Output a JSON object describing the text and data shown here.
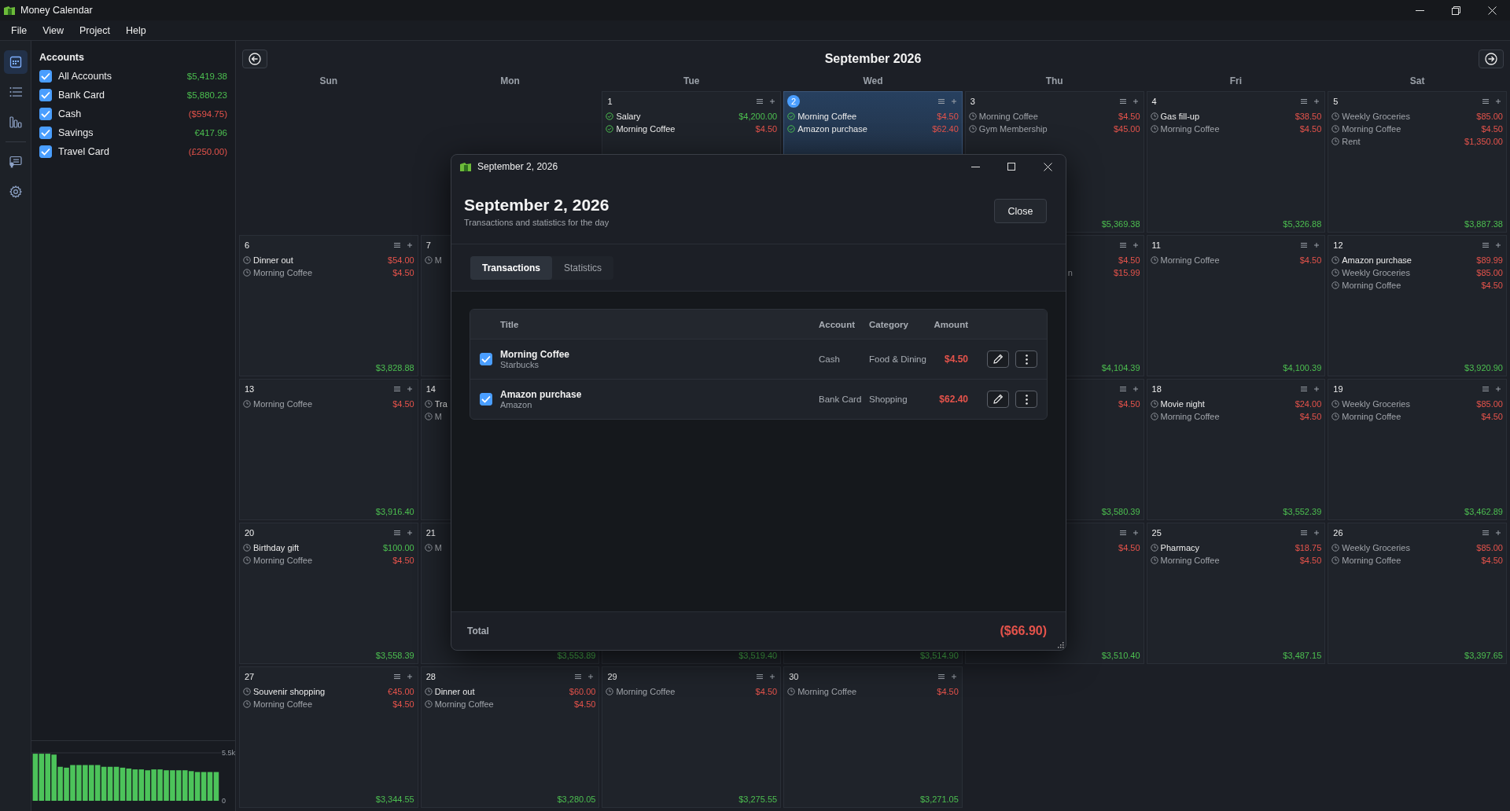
{
  "window": {
    "title": "Money Calendar"
  },
  "menu": [
    "File",
    "View",
    "Project",
    "Help"
  ],
  "rail": [
    {
      "kind": "calendar",
      "selected": true
    },
    {
      "kind": "list",
      "selected": false
    },
    {
      "kind": "chart",
      "selected": false
    },
    {
      "kind": "document",
      "selected": false
    },
    {
      "kind": "settings",
      "selected": false
    }
  ],
  "accounts": {
    "title": "Accounts",
    "items": [
      {
        "name": "All Accounts",
        "balance": "$5,419.38",
        "negative": false,
        "checked": true
      },
      {
        "name": "Bank Card",
        "balance": "$5,880.23",
        "negative": false,
        "checked": true
      },
      {
        "name": "Cash",
        "balance": "($594.75)",
        "negative": true,
        "checked": true
      },
      {
        "name": "Savings",
        "balance": "€417.96",
        "negative": false,
        "checked": true
      },
      {
        "name": "Travel Card",
        "balance": "(£250.00)",
        "negative": true,
        "checked": true
      }
    ]
  },
  "balance_chart": {
    "chart_data": {
      "type": "bar",
      "values": [
        5400,
        5400,
        5400,
        5300,
        3900,
        3800,
        4100,
        4100,
        4100,
        4100,
        4100,
        3900,
        3900,
        3900,
        3800,
        3700,
        3600,
        3600,
        3500,
        3600,
        3600,
        3500,
        3500,
        3500,
        3500,
        3400,
        3300,
        3300,
        3300,
        3300
      ],
      "ylim": [
        0,
        5500
      ],
      "yticks": [
        0,
        {
          "value": 5500,
          "label": "5.5k"
        }
      ]
    }
  },
  "calendar": {
    "month": "September 2026",
    "weekdays": [
      "Sun",
      "Mon",
      "Tue",
      "Wed",
      "Thu",
      "Fri",
      "Sat"
    ],
    "cells": [
      {
        "kind": "empty"
      },
      {
        "kind": "empty"
      },
      {
        "kind": "day",
        "day": "1",
        "selected": false,
        "actions": true,
        "items": [
          {
            "kind": "done",
            "title": "Salary",
            "amount": "$4,200.00",
            "income": true
          },
          {
            "kind": "done",
            "title": "Morning Coffee",
            "amount": "$4.50",
            "income": false
          }
        ]
      },
      {
        "kind": "day",
        "day": "2",
        "selected": true,
        "actions": true,
        "items": [
          {
            "kind": "done",
            "title": "Morning Coffee",
            "amount": "$4.50",
            "income": false
          },
          {
            "kind": "done",
            "title": "Amazon purchase",
            "amount": "$62.40",
            "income": false
          }
        ]
      },
      {
        "kind": "day",
        "day": "3",
        "selected": false,
        "actions": true,
        "items": [
          {
            "kind": "scheduled",
            "title": "Morning Coffee",
            "amount": "$4.50",
            "income": false,
            "recurring": true
          },
          {
            "kind": "scheduled",
            "title": "Gym Membership",
            "amount": "$45.00",
            "income": false,
            "recurring": true
          }
        ],
        "balance": "$5,369.38"
      },
      {
        "kind": "day",
        "day": "4",
        "selected": false,
        "actions": true,
        "items": [
          {
            "kind": "scheduled",
            "title": "Gas fill-up",
            "amount": "$38.50",
            "income": false,
            "recurring": false
          },
          {
            "kind": "scheduled",
            "title": "Morning Coffee",
            "amount": "$4.50",
            "income": false,
            "recurring": true
          }
        ],
        "balance": "$5,326.88"
      },
      {
        "kind": "day",
        "day": "5",
        "selected": false,
        "actions": true,
        "items": [
          {
            "kind": "scheduled",
            "title": "Weekly Groceries",
            "amount": "$85.00",
            "income": false,
            "recurring": true
          },
          {
            "kind": "scheduled",
            "title": "Morning Coffee",
            "amount": "$4.50",
            "income": false,
            "recurring": true
          },
          {
            "kind": "scheduled",
            "title": "Rent",
            "amount": "$1,350.00",
            "income": false,
            "recurring": true
          }
        ],
        "balance": "$3,887.38"
      },
      {
        "kind": "day",
        "day": "6",
        "selected": false,
        "actions": true,
        "items": [
          {
            "kind": "scheduled",
            "title": "Dinner out",
            "amount": "$54.00",
            "income": false,
            "recurring": false
          },
          {
            "kind": "scheduled",
            "title": "Morning Coffee",
            "amount": "$4.50",
            "income": false,
            "recurring": true
          }
        ],
        "balance": "$3,828.88"
      },
      {
        "kind": "day",
        "day": "7",
        "selected": false,
        "items": [
          {
            "kind": "scheduled",
            "title": "M",
            "recurring": true
          }
        ]
      },
      {
        "kind": "empty"
      },
      {
        "kind": "empty"
      },
      {
        "kind": "day",
        "selected": false,
        "actions": true,
        "items": [
          {
            "amount": "$4.50",
            "income": false
          },
          {
            "title": "n",
            "tail": true,
            "amount": "$15.99",
            "income": false,
            "recurring": true
          }
        ],
        "balance": "$4,104.39"
      },
      {
        "kind": "day",
        "day": "11",
        "selected": false,
        "actions": true,
        "items": [
          {
            "kind": "scheduled",
            "title": "Morning Coffee",
            "amount": "$4.50",
            "income": false,
            "recurring": true
          }
        ],
        "balance": "$4,100.39"
      },
      {
        "kind": "day",
        "day": "12",
        "selected": false,
        "actions": true,
        "items": [
          {
            "kind": "scheduled",
            "title": "Amazon purchase",
            "amount": "$89.99",
            "income": false,
            "recurring": false
          },
          {
            "kind": "scheduled",
            "title": "Weekly Groceries",
            "amount": "$85.00",
            "income": false,
            "recurring": true
          },
          {
            "kind": "scheduled",
            "title": "Morning Coffee",
            "amount": "$4.50",
            "income": false,
            "recurring": true
          }
        ],
        "balance": "$3,920.90"
      },
      {
        "kind": "day",
        "day": "13",
        "selected": false,
        "actions": true,
        "items": [
          {
            "kind": "scheduled",
            "title": "Morning Coffee",
            "amount": "$4.50",
            "income": false,
            "recurring": true
          }
        ],
        "balance": "$3,916.40"
      },
      {
        "kind": "day",
        "day": "14",
        "selected": false,
        "items": [
          {
            "kind": "scheduled",
            "title": "Tra",
            "recurring": false
          },
          {
            "kind": "scheduled",
            "title": "M",
            "recurring": true
          }
        ]
      },
      {
        "kind": "empty"
      },
      {
        "kind": "empty"
      },
      {
        "kind": "day",
        "selected": false,
        "actions": true,
        "items": [
          {
            "amount": "$4.50",
            "income": false
          }
        ],
        "balance": "$3,580.39"
      },
      {
        "kind": "day",
        "day": "18",
        "selected": false,
        "actions": true,
        "items": [
          {
            "kind": "scheduled",
            "title": "Movie night",
            "amount": "$24.00",
            "income": false,
            "recurring": false
          },
          {
            "kind": "scheduled",
            "title": "Morning Coffee",
            "amount": "$4.50",
            "income": false,
            "recurring": true
          }
        ],
        "balance": "$3,552.39"
      },
      {
        "kind": "day",
        "day": "19",
        "selected": false,
        "actions": true,
        "items": [
          {
            "kind": "scheduled",
            "title": "Weekly Groceries",
            "amount": "$85.00",
            "income": false,
            "recurring": true
          },
          {
            "kind": "scheduled",
            "title": "Morning Coffee",
            "amount": "$4.50",
            "income": false,
            "recurring": true
          }
        ],
        "balance": "$3,462.89"
      },
      {
        "kind": "day",
        "day": "20",
        "selected": false,
        "actions": true,
        "items": [
          {
            "kind": "scheduled",
            "title": "Birthday gift",
            "amount": "$100.00",
            "income": true,
            "recurring": false
          },
          {
            "kind": "scheduled",
            "title": "Morning Coffee",
            "amount": "$4.50",
            "income": false,
            "recurring": true
          }
        ],
        "balance": "$3,558.39"
      },
      {
        "kind": "day",
        "day": "21",
        "selected": false,
        "items": [
          {
            "kind": "scheduled",
            "title": "M",
            "recurring": true
          }
        ],
        "balance": "$3,553.89"
      },
      {
        "kind": "day",
        "selected": false,
        "balance": "$3,519.40"
      },
      {
        "kind": "day",
        "selected": false,
        "balance": "$3,514.90"
      },
      {
        "kind": "day",
        "selected": false,
        "actions": true,
        "items": [
          {
            "amount": "$4.50",
            "income": false
          }
        ],
        "balance": "$3,510.40"
      },
      {
        "kind": "day",
        "day": "25",
        "selected": false,
        "actions": true,
        "items": [
          {
            "kind": "scheduled",
            "title": "Pharmacy",
            "amount": "$18.75",
            "income": false,
            "recurring": false
          },
          {
            "kind": "scheduled",
            "title": "Morning Coffee",
            "amount": "$4.50",
            "income": false,
            "recurring": true
          }
        ],
        "balance": "$3,487.15"
      },
      {
        "kind": "day",
        "day": "26",
        "selected": false,
        "actions": true,
        "items": [
          {
            "kind": "scheduled",
            "title": "Weekly Groceries",
            "amount": "$85.00",
            "income": false,
            "recurring": true
          },
          {
            "kind": "scheduled",
            "title": "Morning Coffee",
            "amount": "$4.50",
            "income": false,
            "recurring": true
          }
        ],
        "balance": "$3,397.65"
      },
      {
        "kind": "day",
        "day": "27",
        "selected": false,
        "actions": true,
        "items": [
          {
            "kind": "scheduled",
            "title": "Souvenir shopping",
            "amount": "€45.00",
            "income": false,
            "recurring": false
          },
          {
            "kind": "scheduled",
            "title": "Morning Coffee",
            "amount": "$4.50",
            "income": false,
            "recurring": true
          }
        ],
        "balance": "$3,344.55"
      },
      {
        "kind": "day",
        "day": "28",
        "selected": false,
        "actions": true,
        "items": [
          {
            "kind": "scheduled",
            "title": "Dinner out",
            "amount": "$60.00",
            "income": false,
            "recurring": false
          },
          {
            "kind": "scheduled",
            "title": "Morning Coffee",
            "amount": "$4.50",
            "income": false,
            "recurring": true
          }
        ],
        "balance": "$3,280.05"
      },
      {
        "kind": "day",
        "day": "29",
        "selected": false,
        "actions": true,
        "items": [
          {
            "kind": "scheduled",
            "title": "Morning Coffee",
            "amount": "$4.50",
            "income": false,
            "recurring": true
          }
        ],
        "balance": "$3,275.55"
      },
      {
        "kind": "day",
        "day": "30",
        "selected": false,
        "actions": true,
        "items": [
          {
            "kind": "scheduled",
            "title": "Morning Coffee",
            "amount": "$4.50",
            "income": false,
            "recurring": true
          }
        ],
        "balance": "$3,271.05"
      },
      {
        "kind": "empty"
      },
      {
        "kind": "empty"
      },
      {
        "kind": "empty"
      }
    ]
  },
  "dialog": {
    "title": "September 2, 2026",
    "heading": "September 2, 2026",
    "subtitle": "Transactions and statistics for the day",
    "close_label": "Close",
    "tabs": [
      {
        "label": "Transactions",
        "selected": true
      },
      {
        "label": "Statistics",
        "selected": false
      }
    ],
    "columns": [
      "Title",
      "Account",
      "Category",
      "Amount"
    ],
    "transactions": [
      {
        "checked": true,
        "title": "Morning Coffee",
        "payee": "Starbucks",
        "account": "Cash",
        "category": "Food & Dining",
        "amount": "$4.50",
        "income": false
      },
      {
        "checked": true,
        "title": "Amazon purchase",
        "payee": "Amazon",
        "account": "Bank Card",
        "category": "Shopping",
        "amount": "$62.40",
        "income": false
      }
    ],
    "total_label": "Total",
    "total": "($66.90)",
    "total_negative": true
  }
}
